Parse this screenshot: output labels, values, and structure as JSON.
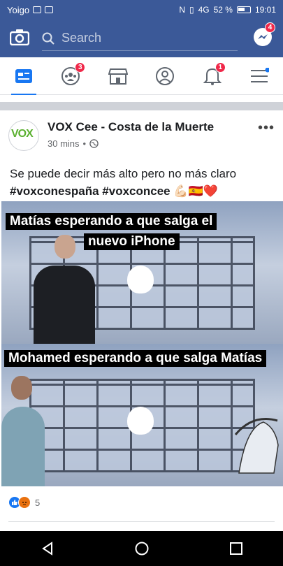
{
  "status_bar": {
    "carrier": "Yoigo",
    "signal": "4G",
    "battery": "52 %",
    "time": "19:01"
  },
  "top_bar": {
    "search_placeholder": "Search",
    "messenger_badge": "4"
  },
  "tabs": [
    {
      "name": "news-feed",
      "badge": ""
    },
    {
      "name": "groups",
      "badge": "3"
    },
    {
      "name": "marketplace",
      "badge": ""
    },
    {
      "name": "profile",
      "badge": ""
    },
    {
      "name": "notifications",
      "badge": "1"
    },
    {
      "name": "menu",
      "badge": ""
    }
  ],
  "post": {
    "page_name": "VOX Cee - Costa de la Muerte",
    "avatar_logo": "VOX",
    "time": "30 mins",
    "text_line1": "Se puede decir más alto pero no más claro",
    "hashtag1": "#voxconespaña",
    "hashtag2": "#voxconcee",
    "emojis": "💪🏻🇪🇸❤️",
    "meme": {
      "caption_top_line1": "Matías esperando a que salga el",
      "caption_top_line2": "nuevo iPhone",
      "caption_bottom": "Mohamed esperando a que salga Matías"
    },
    "reaction_count": "5"
  },
  "colors": {
    "brand": "#3b5998",
    "badge": "#f02849",
    "accent": "#1877f2"
  }
}
